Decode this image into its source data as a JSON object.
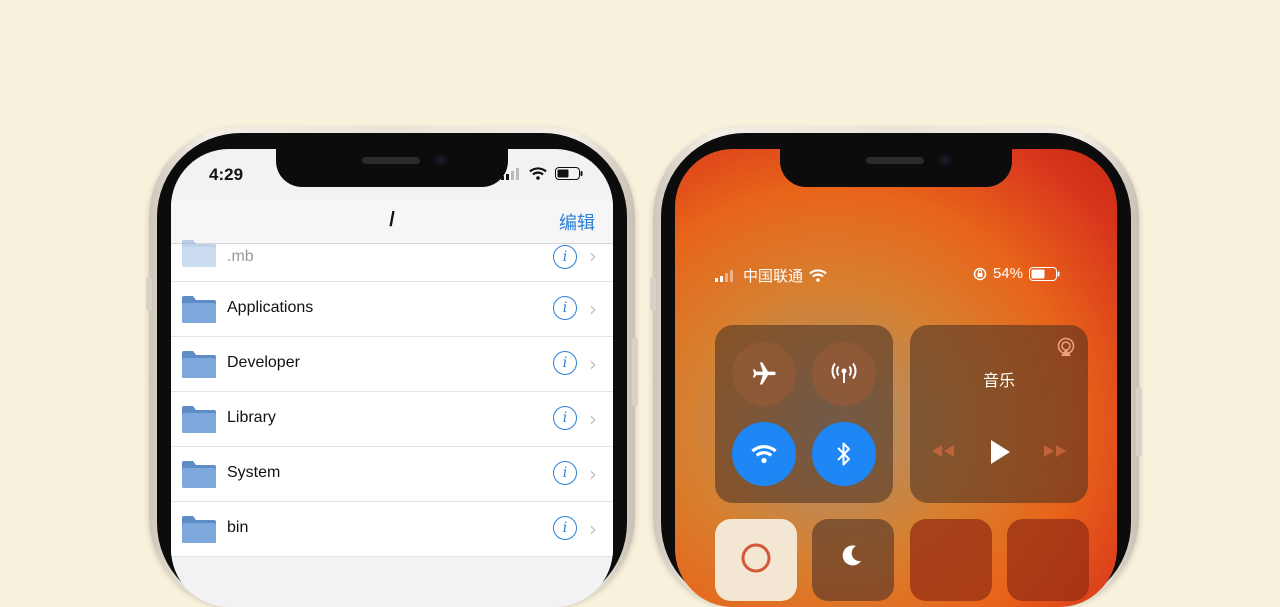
{
  "left_phone": {
    "status_bar": {
      "time": "4:29"
    },
    "nav": {
      "title": "/",
      "edit_label": "编辑"
    },
    "rows": [
      {
        "label": ".mb"
      },
      {
        "label": "Applications"
      },
      {
        "label": "Developer"
      },
      {
        "label": "Library"
      },
      {
        "label": "System"
      },
      {
        "label": "bin"
      }
    ]
  },
  "right_phone": {
    "status_bar": {
      "carrier": "中国联通",
      "battery": "54%"
    },
    "connectivity": {
      "airplane": "airplane-icon",
      "cellular": "cellular-data-icon",
      "wifi": "wifi-icon",
      "bluetooth": "bluetooth-icon"
    },
    "music": {
      "title": "音乐"
    }
  },
  "colors": {
    "accent_blue": "#2b7fd6",
    "toggle_on": "#1f86f5",
    "background": "#f8f1dc"
  }
}
